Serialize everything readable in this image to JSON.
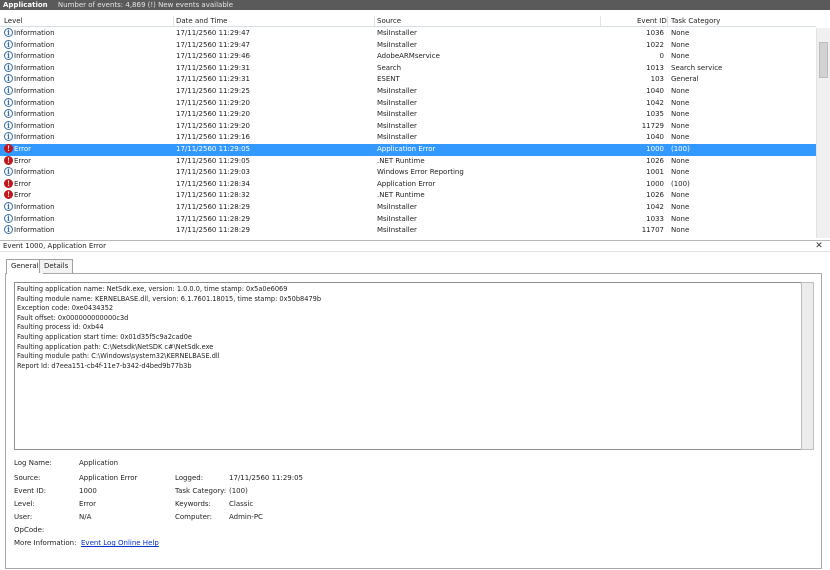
{
  "window": {
    "title": "Application",
    "event_count": "Number of events: 4,869 (!) New events available"
  },
  "columns": {
    "level": "Level",
    "date": "Date and Time",
    "source": "Source",
    "event_id": "Event ID",
    "task_category": "Task Category"
  },
  "events": [
    {
      "level": "Information",
      "date": "17/11/2560 11:29:47",
      "source": "MsiInstaller",
      "event_id": "1036",
      "category": "None",
      "type": "info"
    },
    {
      "level": "Information",
      "date": "17/11/2560 11:29:47",
      "source": "MsiInstaller",
      "event_id": "1022",
      "category": "None",
      "type": "info"
    },
    {
      "level": "Information",
      "date": "17/11/2560 11:29:46",
      "source": "AdobeARMservice",
      "event_id": "0",
      "category": "None",
      "type": "info"
    },
    {
      "level": "Information",
      "date": "17/11/2560 11:29:31",
      "source": "Search",
      "event_id": "1013",
      "category": "Search service",
      "type": "info"
    },
    {
      "level": "Information",
      "date": "17/11/2560 11:29:31",
      "source": "ESENT",
      "event_id": "103",
      "category": "General",
      "type": "info"
    },
    {
      "level": "Information",
      "date": "17/11/2560 11:29:25",
      "source": "MsiInstaller",
      "event_id": "1040",
      "category": "None",
      "type": "info"
    },
    {
      "level": "Information",
      "date": "17/11/2560 11:29:20",
      "source": "MsiInstaller",
      "event_id": "1042",
      "category": "None",
      "type": "info"
    },
    {
      "level": "Information",
      "date": "17/11/2560 11:29:20",
      "source": "MsiInstaller",
      "event_id": "1035",
      "category": "None",
      "type": "info"
    },
    {
      "level": "Information",
      "date": "17/11/2560 11:29:20",
      "source": "MsiInstaller",
      "event_id": "11729",
      "category": "None",
      "type": "info"
    },
    {
      "level": "Information",
      "date": "17/11/2560 11:29:16",
      "source": "MsiInstaller",
      "event_id": "1040",
      "category": "None",
      "type": "info"
    },
    {
      "level": "Error",
      "date": "17/11/2560 11:29:05",
      "source": "Application Error",
      "event_id": "1000",
      "category": "(100)",
      "type": "err",
      "selected": true
    },
    {
      "level": "Error",
      "date": "17/11/2560 11:29:05",
      "source": ".NET Runtime",
      "event_id": "1026",
      "category": "None",
      "type": "err"
    },
    {
      "level": "Information",
      "date": "17/11/2560 11:29:03",
      "source": "Windows Error Reporting",
      "event_id": "1001",
      "category": "None",
      "type": "info"
    },
    {
      "level": "Error",
      "date": "17/11/2560 11:28:34",
      "source": "Application Error",
      "event_id": "1000",
      "category": "(100)",
      "type": "err"
    },
    {
      "level": "Error",
      "date": "17/11/2560 11:28:32",
      "source": ".NET Runtime",
      "event_id": "1026",
      "category": "None",
      "type": "err"
    },
    {
      "level": "Information",
      "date": "17/11/2560 11:28:29",
      "source": "MsiInstaller",
      "event_id": "1042",
      "category": "None",
      "type": "info"
    },
    {
      "level": "Information",
      "date": "17/11/2560 11:28:29",
      "source": "MsiInstaller",
      "event_id": "1033",
      "category": "None",
      "type": "info"
    },
    {
      "level": "Information",
      "date": "17/11/2560 11:28:29",
      "source": "MsiInstaller",
      "event_id": "11707",
      "category": "None",
      "type": "info"
    }
  ],
  "detail": {
    "header": "Event 1000, Application Error",
    "tabs": [
      "General",
      "Details"
    ],
    "description_lines": [
      "Faulting application name: NetSdk.exe, version: 1.0.0.0, time stamp: 0x5a0e6069",
      "Faulting module name: KERNELBASE.dll, version: 6.1.7601.18015, time stamp: 0x50b8479b",
      "Exception code: 0xe0434352",
      "Fault offset: 0x000000000000c3d",
      "Faulting process id: 0xb44",
      "Faulting application start time: 0x01d35f5c9a2cad0e",
      "Faulting application path: C:\\Netsdk\\NetSDK c#\\NetSdk.exe",
      "Faulting module path: C:\\Windows\\system32\\KERNELBASE.dll",
      "Report Id: d7eea151-cb4f-11e7-b342-d4bed9b77b3b"
    ],
    "props": {
      "log_name_label": "Log Name:",
      "log_name": "Application",
      "source_label": "Source:",
      "source": "Application Error",
      "logged_label": "Logged:",
      "logged": "17/11/2560 11:29:05",
      "event_id_label": "Event ID:",
      "event_id": "1000",
      "task_label": "Task Category:",
      "task": "(100)",
      "level_label": "Level:",
      "level": "Error",
      "keywords_label": "Keywords:",
      "keywords": "Classic",
      "user_label": "User:",
      "user": "N/A",
      "computer_label": "Computer:",
      "computer": "Admin-PC",
      "opcode_label": "OpCode:",
      "more_info_label": "More Information:",
      "more_info_link": "Event Log Online Help"
    }
  },
  "colors": {
    "selection": "#3399ff",
    "error_icon": "#c0161c",
    "info_icon": "#3a6ea5",
    "link": "#0033cc"
  }
}
